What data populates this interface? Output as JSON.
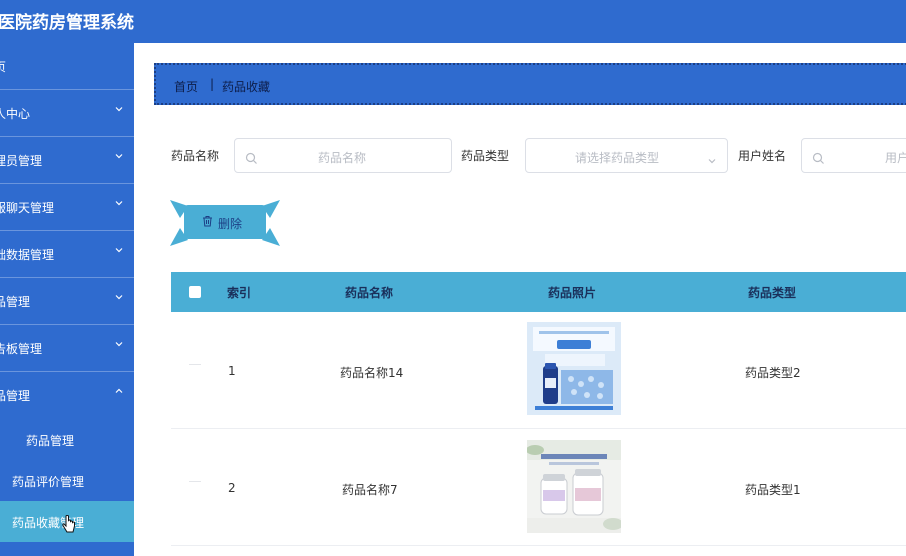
{
  "app": {
    "title": "医院药房管理系统"
  },
  "sidebar": {
    "items": [
      {
        "label": "页",
        "has_chevron": false
      },
      {
        "label": "人中心",
        "has_chevron": true
      },
      {
        "label": "理员管理",
        "has_chevron": true
      },
      {
        "label": "服聊天管理",
        "has_chevron": true
      },
      {
        "label": "础数据管理",
        "has_chevron": true
      },
      {
        "label": "品管理",
        "has_chevron": true
      },
      {
        "label": "告板管理",
        "has_chevron": true
      },
      {
        "label": "品管理",
        "has_chevron": true
      }
    ],
    "sub_items": [
      {
        "label": "药品管理"
      },
      {
        "label": "药品评价管理"
      },
      {
        "label": "药品收藏管理"
      }
    ]
  },
  "breadcrumb": {
    "home": "首页",
    "separator": "|",
    "current": "药品收藏"
  },
  "filters": {
    "drug_name": {
      "label": "药品名称",
      "placeholder": "药品名称"
    },
    "drug_type": {
      "label": "药品类型",
      "placeholder": "请选择药品类型"
    },
    "user_name": {
      "label": "用户姓名",
      "placeholder": "用户"
    }
  },
  "toolbar": {
    "delete_label": "删除"
  },
  "table": {
    "columns": [
      "索引",
      "药品名称",
      "药品照片",
      "药品类型"
    ],
    "rows": [
      {
        "index": "1",
        "name": "药品名称14",
        "type": "药品类型2"
      },
      {
        "index": "2",
        "name": "药品名称7",
        "type": "药品类型1"
      }
    ]
  },
  "colors": {
    "primary": "#2f6bcf",
    "accent": "#4aaed5",
    "breadcrumb_text": "#0d1e4a"
  }
}
